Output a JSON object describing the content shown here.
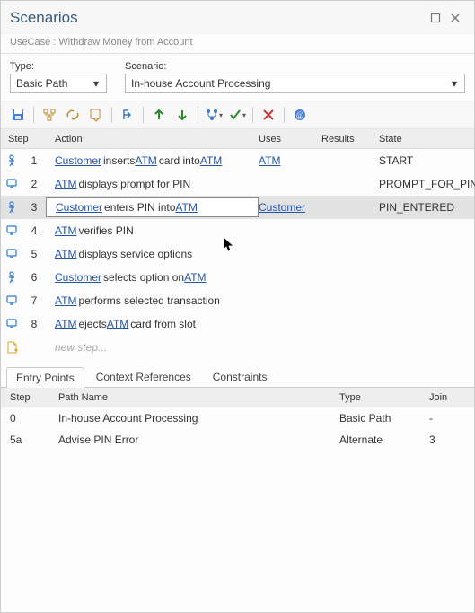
{
  "window": {
    "title": "Scenarios",
    "subtitle": "UseCase : Withdraw Money from Account"
  },
  "selectors": {
    "type_label": "Type:",
    "type_value": "Basic Path",
    "scenario_label": "Scenario:",
    "scenario_value": "In-house Account Processing"
  },
  "columns": {
    "step": "Step",
    "action": "Action",
    "uses": "Uses",
    "results": "Results",
    "state": "State"
  },
  "steps": [
    {
      "icon": "actor",
      "n": "1",
      "tokens": [
        {
          "t": "Customer",
          "link": true
        },
        {
          "t": " inserts "
        },
        {
          "t": "ATM ",
          "link": true
        },
        {
          "t": "card into "
        },
        {
          "t": "ATM",
          "link": true
        }
      ],
      "uses": "ATM",
      "uses_link": true,
      "results": "",
      "state": "START",
      "selected": false
    },
    {
      "icon": "screen",
      "n": "2",
      "tokens": [
        {
          "t": "ATM",
          "link": true
        },
        {
          "t": " displays prompt for PIN"
        }
      ],
      "uses": "",
      "results": "",
      "state": "PROMPT_FOR_PIN",
      "selected": false
    },
    {
      "icon": "actor",
      "n": "3",
      "tokens": [
        {
          "t": "Customer",
          "link": true
        },
        {
          "t": " enters PIN into "
        },
        {
          "t": "ATM",
          "link": true
        }
      ],
      "uses": "Customer",
      "uses_link": true,
      "results": "",
      "state": "PIN_ENTERED",
      "selected": true
    },
    {
      "icon": "screen",
      "n": "4",
      "tokens": [
        {
          "t": "ATM",
          "link": true
        },
        {
          "t": " verifies PIN"
        }
      ],
      "uses": "",
      "results": "",
      "state": "",
      "selected": false
    },
    {
      "icon": "screen",
      "n": "5",
      "tokens": [
        {
          "t": "ATM",
          "link": true
        },
        {
          "t": " displays service options"
        }
      ],
      "uses": "",
      "results": "",
      "state": "",
      "selected": false
    },
    {
      "icon": "actor",
      "n": "6",
      "tokens": [
        {
          "t": "Customer",
          "link": true
        },
        {
          "t": " selects option on "
        },
        {
          "t": "ATM",
          "link": true
        }
      ],
      "uses": "",
      "results": "",
      "state": "",
      "selected": false
    },
    {
      "icon": "screen",
      "n": "7",
      "tokens": [
        {
          "t": "ATM",
          "link": true
        },
        {
          "t": " performs selected transaction"
        }
      ],
      "uses": "",
      "results": "",
      "state": "",
      "selected": false
    },
    {
      "icon": "screen",
      "n": "8",
      "tokens": [
        {
          "t": "ATM",
          "link": true
        },
        {
          "t": " ejects "
        },
        {
          "t": "ATM ",
          "link": true
        },
        {
          "t": "card from slot"
        }
      ],
      "uses": "",
      "results": "",
      "state": "",
      "selected": false
    }
  ],
  "new_step_placeholder": "new step...",
  "tabs": {
    "items": [
      "Entry Points",
      "Context References",
      "Constraints"
    ],
    "active": 0
  },
  "bottom_columns": {
    "step": "Step",
    "path": "Path Name",
    "type": "Type",
    "join": "Join"
  },
  "entry_points": [
    {
      "step": "0",
      "path": "In-house Account Processing",
      "type": "Basic Path",
      "join": "-"
    },
    {
      "step": "5a",
      "path": "Advise PIN Error",
      "type": "Alternate",
      "join": "3"
    }
  ],
  "icons": {
    "actor_color": "#2b7bd9",
    "screen_color": "#2b7bd9",
    "newdoc_color": "#d9a52b"
  }
}
